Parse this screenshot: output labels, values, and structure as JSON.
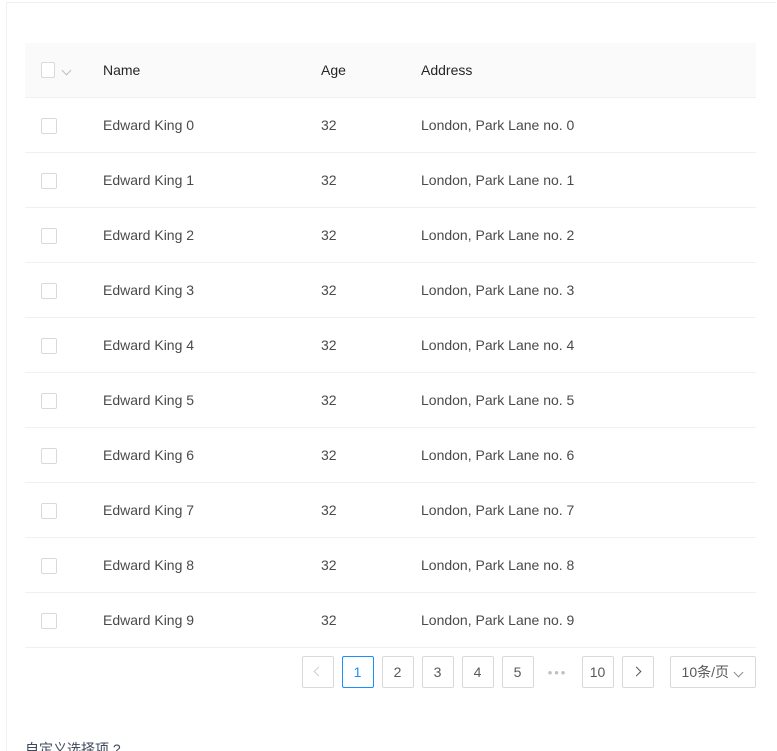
{
  "table": {
    "columns": [
      {
        "key": "select",
        "label": ""
      },
      {
        "key": "name",
        "label": "Name"
      },
      {
        "key": "age",
        "label": "Age"
      },
      {
        "key": "address",
        "label": "Address"
      }
    ],
    "header_select_all_checked": false,
    "rows": [
      {
        "name": "Edward King 0",
        "age": "32",
        "address": "London, Park Lane no. 0",
        "checked": false
      },
      {
        "name": "Edward King 1",
        "age": "32",
        "address": "London, Park Lane no. 1",
        "checked": false
      },
      {
        "name": "Edward King 2",
        "age": "32",
        "address": "London, Park Lane no. 2",
        "checked": false
      },
      {
        "name": "Edward King 3",
        "age": "32",
        "address": "London, Park Lane no. 3",
        "checked": false
      },
      {
        "name": "Edward King 4",
        "age": "32",
        "address": "London, Park Lane no. 4",
        "checked": false
      },
      {
        "name": "Edward King 5",
        "age": "32",
        "address": "London, Park Lane no. 5",
        "checked": false
      },
      {
        "name": "Edward King 6",
        "age": "32",
        "address": "London, Park Lane no. 6",
        "checked": false
      },
      {
        "name": "Edward King 7",
        "age": "32",
        "address": "London, Park Lane no. 7",
        "checked": false
      },
      {
        "name": "Edward King 8",
        "age": "32",
        "address": "London, Park Lane no. 8",
        "checked": false
      },
      {
        "name": "Edward King 9",
        "age": "32",
        "address": "London, Park Lane no. 9",
        "checked": false
      }
    ]
  },
  "pagination": {
    "prev_icon": "chevron-left-icon",
    "next_icon": "chevron-right-icon",
    "pages": [
      "1",
      "2",
      "3",
      "4",
      "5"
    ],
    "ellipsis": "•••",
    "last_page": "10",
    "current_page": "1",
    "page_size_label": "10条/页",
    "page_size_icon": "chevron-down-icon",
    "active_color": "#1890ff"
  },
  "footer": {
    "note": "自定义选择项 ?"
  }
}
